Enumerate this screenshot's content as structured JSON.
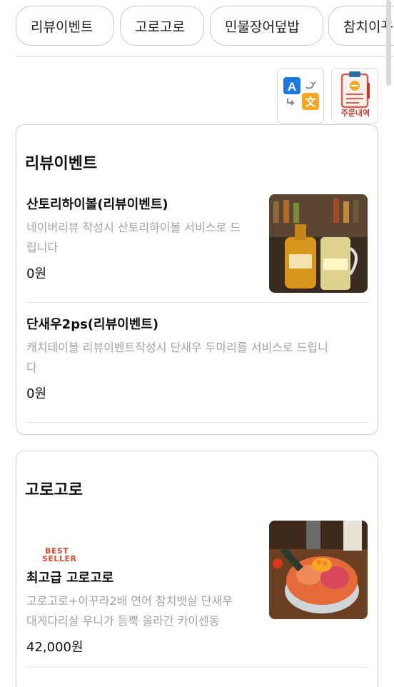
{
  "categories": [
    "리뷰이벤트",
    "고로고로",
    "민물장어덮밥",
    "참치이꾸"
  ],
  "tools": {
    "translate_glyph_a": "A",
    "translate_glyph_b": "文",
    "orders_label": "주문내역"
  },
  "sections": [
    {
      "title": "리뷰이벤트",
      "items": [
        {
          "name": "산토리하이볼(리뷰이벤트)",
          "desc_line1": "네이버리뷰 작성시 산토리하이볼 서비스로 드",
          "desc_line2": "립니다",
          "price": "0원",
          "badge": ""
        },
        {
          "name": "단새우2ps(리뷰이벤트)",
          "desc_line1": "캐치테이블 리뷰이벤트작성시 단새우 두마리를 서비스로 드립니",
          "desc_line2": "다",
          "price": "0원",
          "badge": ""
        }
      ]
    },
    {
      "title": "고로고로",
      "items": [
        {
          "badge_line1": "BEST",
          "badge_line2": "SELLER",
          "name": "최고급 고로고로",
          "desc_line1": "고로고로+이꾸라2배 연어 참치뱃살 단새우",
          "desc_line2": "대게다리살 우니가 듬뿍 올라간 카이센동",
          "price": "42,000원"
        }
      ]
    }
  ],
  "colors": {
    "translate_blue": "#1f7ae0",
    "translate_orange": "#f4a825",
    "badge_red": "#d64a2b",
    "desc_gray": "#a3a3a3"
  }
}
